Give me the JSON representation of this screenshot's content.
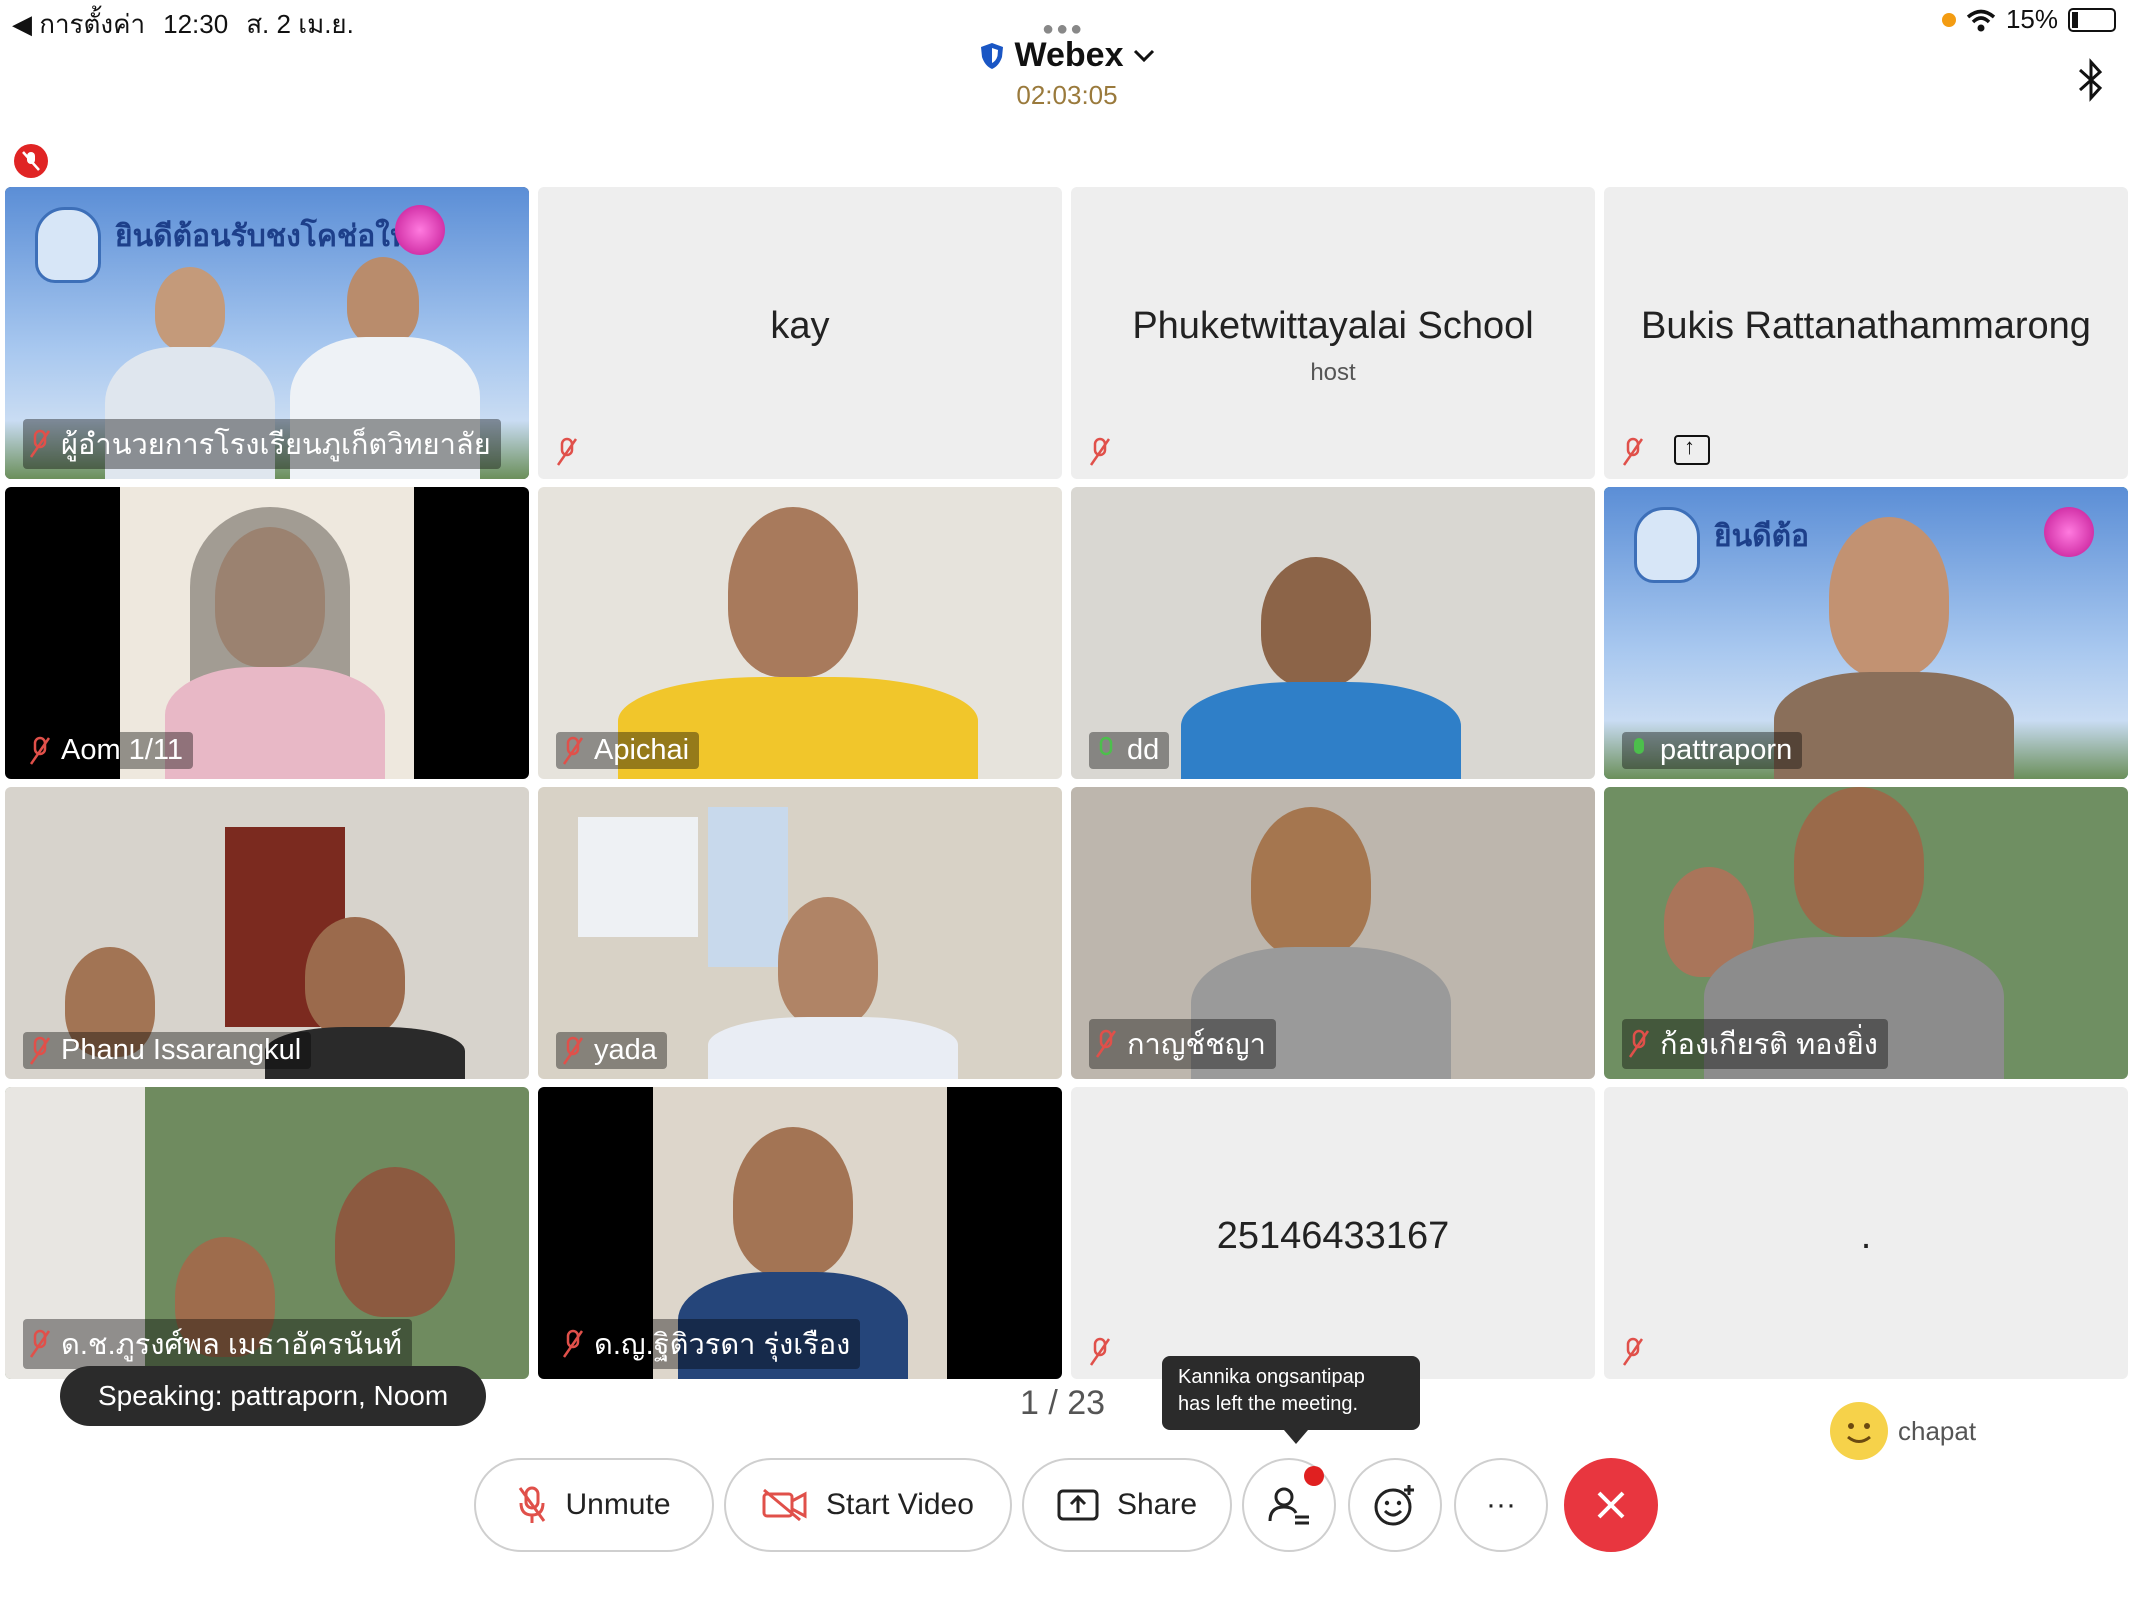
{
  "status_bar": {
    "back_label": "◀ การตั้งค่า",
    "time": "12:30",
    "date": "ส. 2 เม.ย.",
    "battery": "15%"
  },
  "header": {
    "app_title": "Webex",
    "meeting_timer": "02:03:05"
  },
  "tiles": [
    {
      "name": "ผู้อำนวยการโรงเรียนภูเก็ตวิทยาลัย",
      "banner": "ยินดีต้อนรับชงโคช่อใหม่"
    },
    {
      "name": "kay"
    },
    {
      "name": "Phuketwittayalai School",
      "role": "host"
    },
    {
      "name": "Bukis Rattanathammarong"
    },
    {
      "name": "Aom 1/11"
    },
    {
      "name": "Apichai"
    },
    {
      "name": "dd"
    },
    {
      "name": "pattraporn",
      "banner": "ยินดีต้อ"
    },
    {
      "name": "Phanu Issarangkul"
    },
    {
      "name": "yada"
    },
    {
      "name": "กาญช์ชญา"
    },
    {
      "name": "ก้องเกียรติ ทองยิ่ง"
    },
    {
      "name": "ด.ช.ภูรงศ์พล เมธาอัครนันท์"
    },
    {
      "name": "ด.ญ.ฐิติวรดา รุ่งเรือง"
    },
    {
      "name": "25146433167"
    },
    {
      "name": "."
    }
  ],
  "speaking_tooltip": "Speaking: pattraporn, Noom",
  "page_indicator": "1 / 23",
  "toast": {
    "line1": "Kannika ongsantipap",
    "line2": "has left the meeting."
  },
  "chat_preview": {
    "name": "chapat"
  },
  "controls": {
    "unmute": "Unmute",
    "start_video": "Start Video",
    "share": "Share",
    "more": "···"
  },
  "colors": {
    "end_call": "#e8363f",
    "active_speaker_border": "#34c3c3",
    "muted_mic": "#e0504a",
    "timer": "#9a7a3c"
  }
}
